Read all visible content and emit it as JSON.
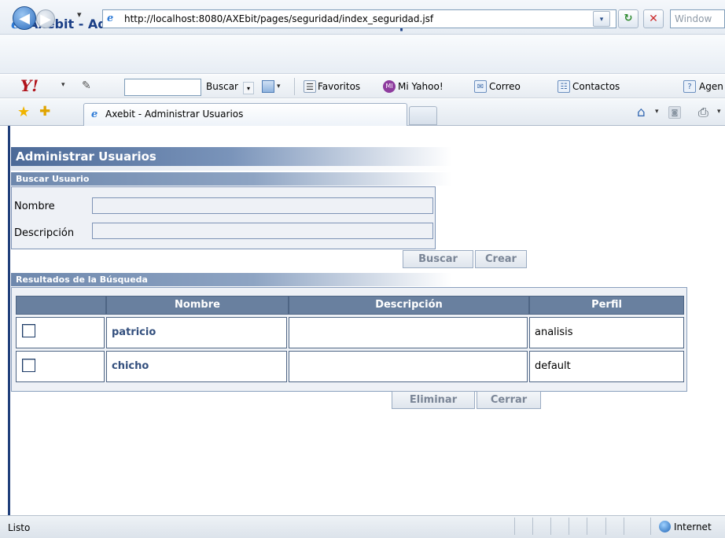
{
  "window": {
    "title": "Axebit - Administrar Usuarios - Windows Internet Explorer",
    "ie_icon": "e"
  },
  "address_bar": {
    "url": "http://localhost:8080/AXEbit/pages/seguridad/index_seguridad.jsf",
    "search_placeholder": "Window",
    "dropdown_glyph": "▾",
    "refresh_glyph": "↻",
    "stop_glyph": "✕",
    "back_glyph": "◀",
    "forward_glyph": "▶",
    "page_icon": "e"
  },
  "yahoo_toolbar": {
    "logo": "Y!",
    "drop_glyph": "▾",
    "pencil_glyph": "✎",
    "search_button": "Buscar",
    "favorites": "Favoritos",
    "my_yahoo": "Mi Yahoo!",
    "mail": "Correo",
    "contacts": "Contactos",
    "agenda": "Agen",
    "fav_icon_glyph": "☰",
    "my_yahoo_icon_glyph": "MI",
    "mail_icon_glyph": "✉",
    "contacts_icon_glyph": "☷",
    "agenda_icon_glyph": "?"
  },
  "tabs": {
    "active_label": "Axebit - Administrar Usuarios",
    "tab_icon": "e",
    "star_glyph": "★",
    "add_fav_glyph": "✚",
    "home_glyph": "⌂",
    "feeds_glyph": "◙",
    "print_glyph": "⎙",
    "drop_glyph": "▾"
  },
  "page": {
    "title": "Administrar Usuarios",
    "search_section": {
      "title": "Buscar Usuario",
      "nombre_label": "Nombre",
      "nombre_value": "",
      "descripcion_label": "Descripción",
      "descripcion_value": "",
      "buscar_button": "Buscar",
      "crear_button": "Crear"
    },
    "results_section": {
      "title": "Resultados de la Búsqueda",
      "columns": [
        "",
        "Nombre",
        "Descripción",
        "Perfil"
      ],
      "rows": [
        {
          "checked": false,
          "nombre": "patricio",
          "descripcion": "",
          "perfil": "analisis"
        },
        {
          "checked": false,
          "nombre": "chicho",
          "descripcion": "",
          "perfil": "default"
        }
      ],
      "eliminar_button": "Eliminar",
      "cerrar_button": "Cerrar"
    }
  },
  "status_bar": {
    "status": "Listo",
    "zone": "Internet"
  },
  "colors": {
    "header_blue": "#69809f",
    "title_text_blue": "#1b3f86",
    "link_blue": "#34507e",
    "panel_bg": "#eef1f6"
  }
}
